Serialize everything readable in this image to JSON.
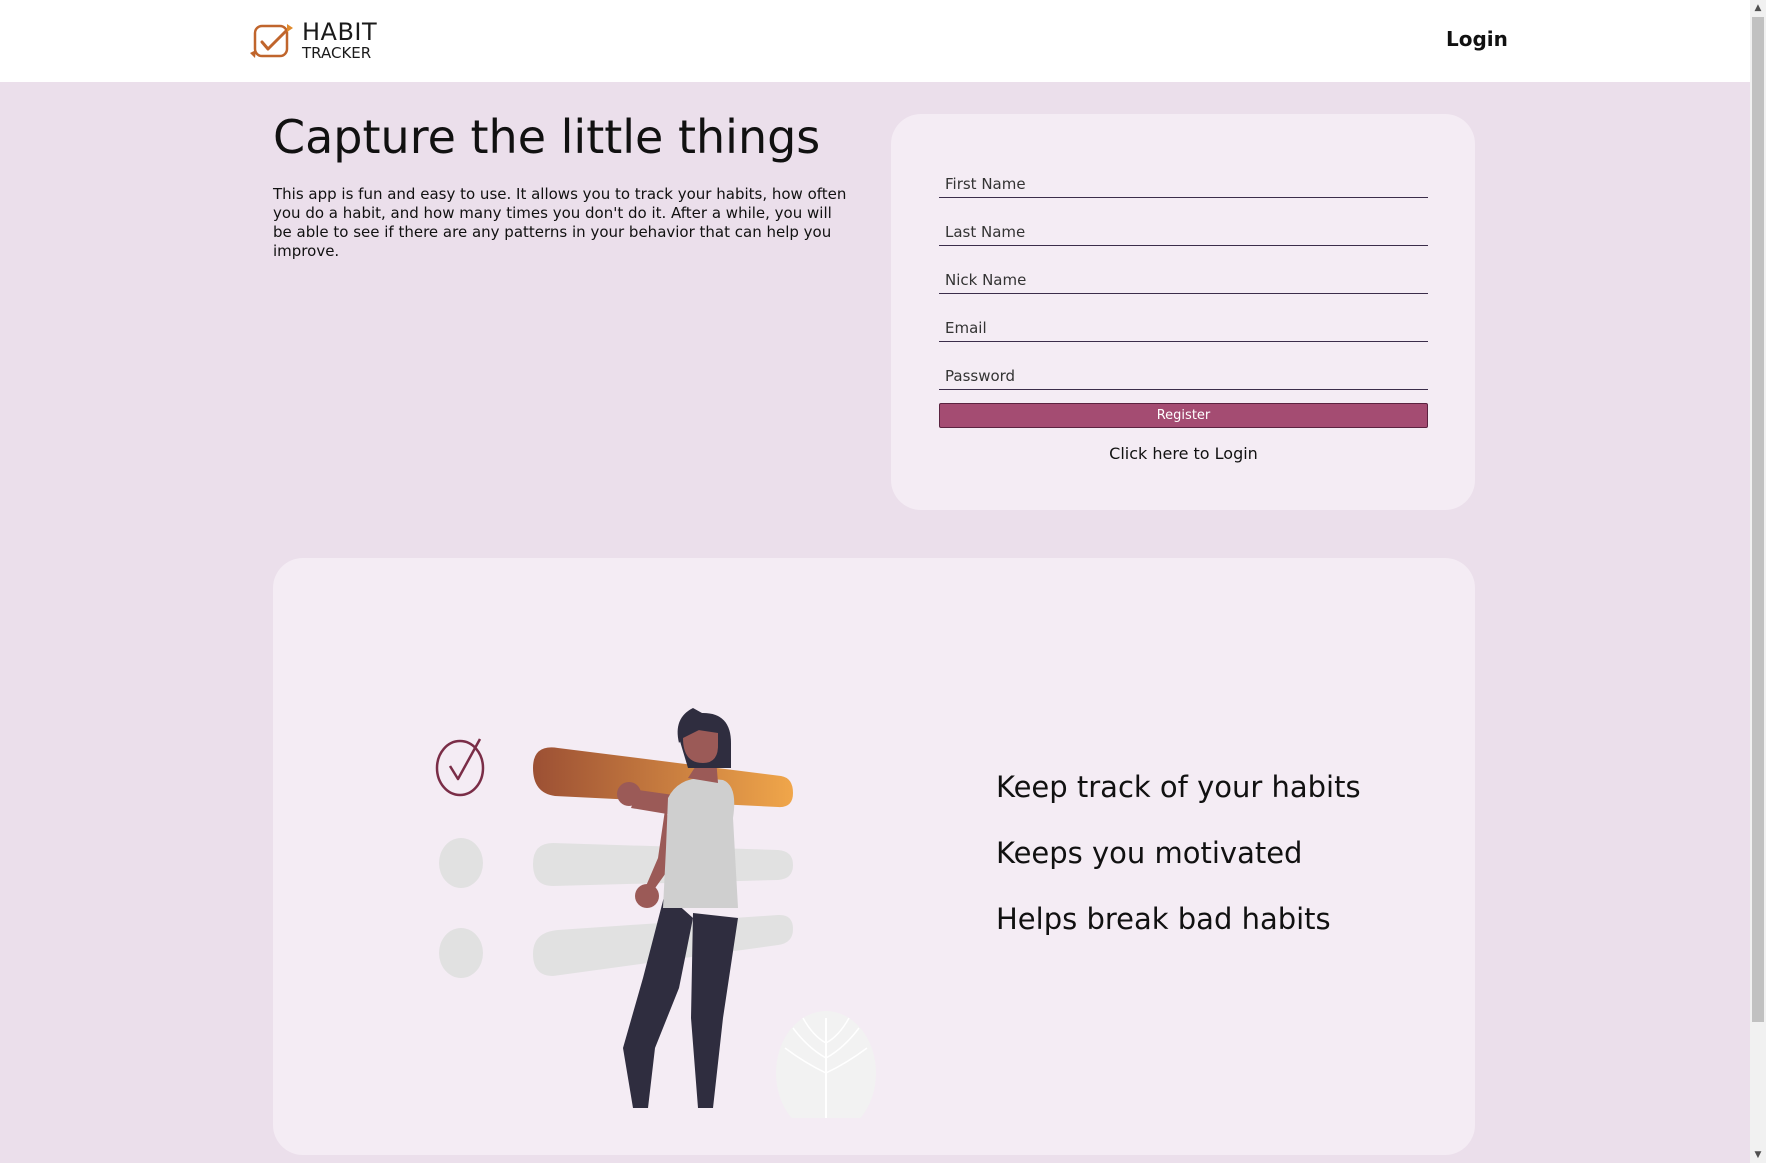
{
  "header": {
    "logo_line1": "HABIT",
    "logo_line2": "TRACKER",
    "login_label": "Login"
  },
  "hero": {
    "title": "Capture the little things",
    "description": "This app is fun and easy to use. It allows you to track your habits, how often you do a habit, and how many times you don't do it. After a while, you will be able to see if there are any patterns in your behavior that can help you improve."
  },
  "register_form": {
    "first_name_placeholder": "First Name",
    "last_name_placeholder": "Last Name",
    "nick_name_placeholder": "Nick Name",
    "email_placeholder": "Email",
    "password_placeholder": "Password",
    "register_label": "Register",
    "login_link": "Click here to Login"
  },
  "features": [
    "Keep track of your habits",
    "Keeps you motivated",
    "Helps break bad habits"
  ],
  "colors": {
    "page_bg": "#ebdfeb",
    "card_bg": "#f4ecf4",
    "accent": "#a44c72",
    "logo_accent": "#e08a2c"
  },
  "icons": {
    "logo": "checkbox-refresh-icon",
    "illustration_check": "check-circle-icon"
  }
}
